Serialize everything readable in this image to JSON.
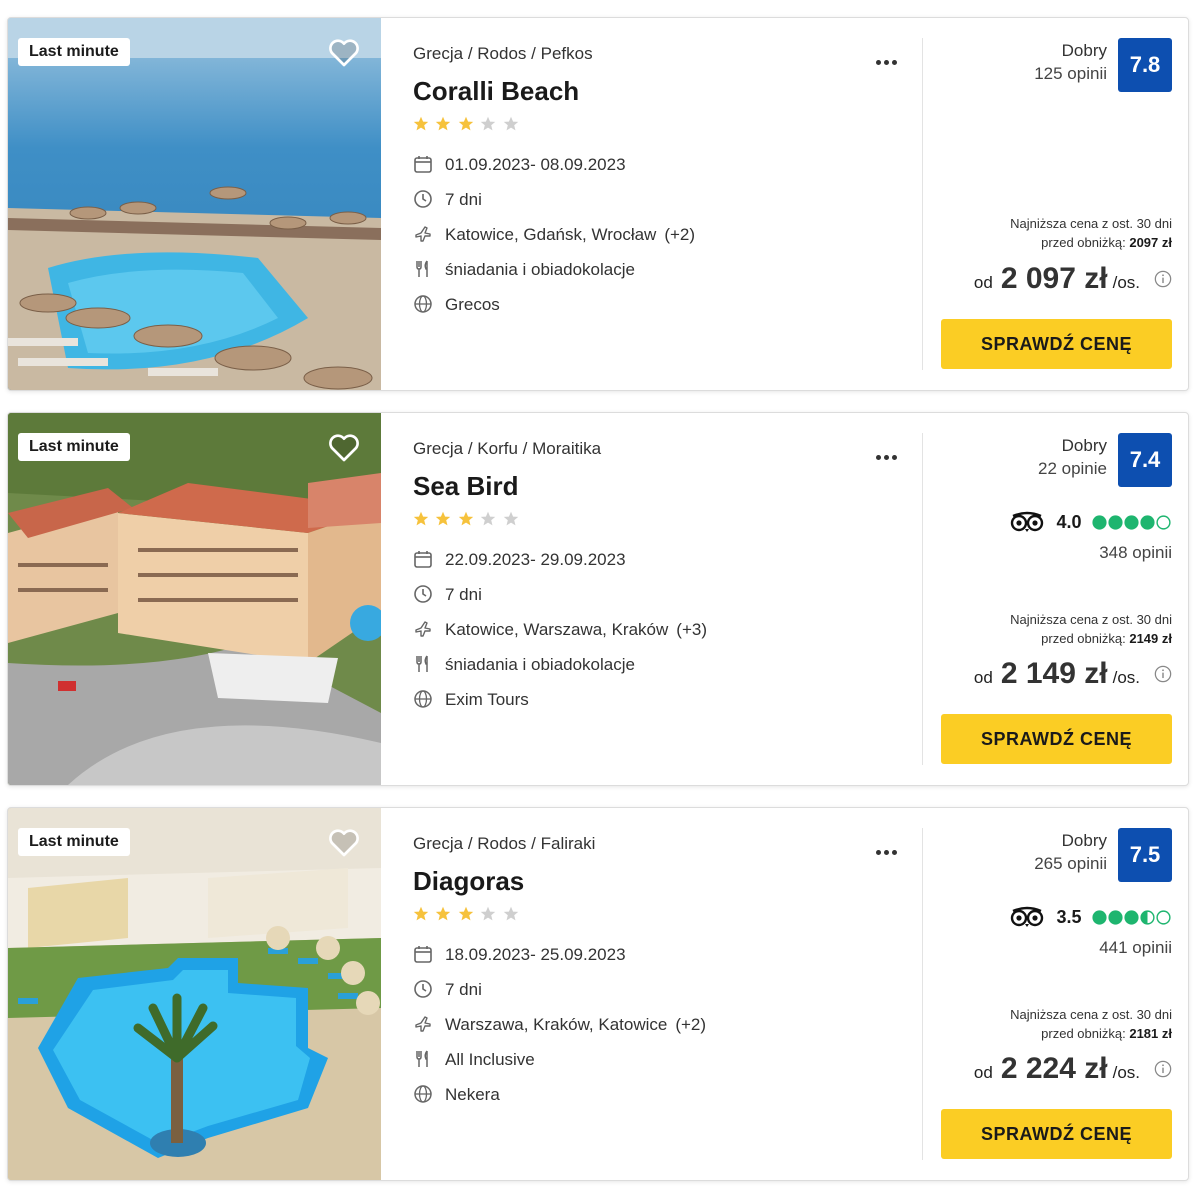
{
  "colors": {
    "accent_yellow": "#fbcd24",
    "score_blue": "#0d4fb0",
    "star_gold": "#f6c23c",
    "star_grey": "#cfcfcf",
    "tripadvisor_green": "#1eb56f"
  },
  "offers": [
    {
      "badge": "Last minute",
      "location": {
        "country": "Grecja",
        "region": "Rodos",
        "place": "Pefkos",
        "sep": "/"
      },
      "name": "Coralli Beach",
      "stars": 3,
      "max_stars": 5,
      "dates": "01.09.2023- 08.09.2023",
      "duration": "7 dni",
      "departure": "Katowice, Gdańsk, Wrocław",
      "departure_more": "(+2)",
      "board": "śniadania i obiadokolacje",
      "operator": "Grecos",
      "rating_label": "Dobry",
      "reviews": "125 opinii",
      "score": "7.8",
      "tripadvisor": null,
      "lowest_text": "Najniższa cena z ost. 30 dni",
      "lowest_before": "przed obniżką:",
      "lowest_value": "2097 zł",
      "price_prefix": "od",
      "price": "2 097 zł",
      "price_suffix": "/os.",
      "cta": "SPRAWDŹ CENĘ"
    },
    {
      "badge": "Last minute",
      "location": {
        "country": "Grecja",
        "region": "Korfu",
        "place": "Moraitika",
        "sep": "/"
      },
      "name": "Sea Bird",
      "stars": 3,
      "max_stars": 5,
      "dates": "22.09.2023- 29.09.2023",
      "duration": "7 dni",
      "departure": "Katowice, Warszawa, Kraków",
      "departure_more": "(+3)",
      "board": "śniadania i obiadokolacje",
      "operator": "Exim Tours",
      "rating_label": "Dobry",
      "reviews": "22 opinie",
      "score": "7.4",
      "tripadvisor": {
        "value": "4.0",
        "rating": 4.0,
        "reviews": "348 opinii"
      },
      "lowest_text": "Najniższa cena z ost. 30 dni",
      "lowest_before": "przed obniżką:",
      "lowest_value": "2149 zł",
      "price_prefix": "od",
      "price": "2 149 zł",
      "price_suffix": "/os.",
      "cta": "SPRAWDŹ CENĘ"
    },
    {
      "badge": "Last minute",
      "location": {
        "country": "Grecja",
        "region": "Rodos",
        "place": "Faliraki",
        "sep": "/"
      },
      "name": "Diagoras",
      "stars": 3,
      "max_stars": 5,
      "dates": "18.09.2023- 25.09.2023",
      "duration": "7 dni",
      "departure": "Warszawa, Kraków, Katowice",
      "departure_more": "(+2)",
      "board": "All Inclusive",
      "operator": "Nekera",
      "rating_label": "Dobry",
      "reviews": "265 opinii",
      "score": "7.5",
      "tripadvisor": {
        "value": "3.5",
        "rating": 3.5,
        "reviews": "441 opinii"
      },
      "lowest_text": "Najniższa cena z ost. 30 dni",
      "lowest_before": "przed obniżką:",
      "lowest_value": "2181 zł",
      "price_prefix": "od",
      "price": "2 224 zł",
      "price_suffix": "/os.",
      "cta": "SPRAWDŹ CENĘ"
    }
  ]
}
